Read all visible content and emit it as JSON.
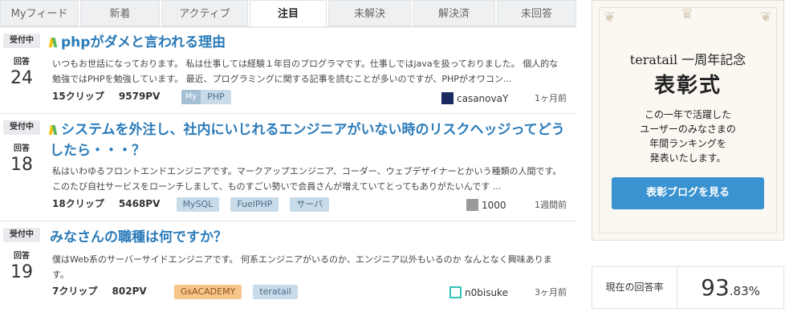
{
  "tabs": [
    "Myフィード",
    "新着",
    "アクティブ",
    "注目",
    "未解決",
    "解決済",
    "未回答"
  ],
  "questions": [
    {
      "status": "受付中",
      "answers_label": "回答",
      "answers": "24",
      "title": "phpがダメと言われる理由",
      "body": "いつもお世話になっております。 私は仕事しては経験１年目のプログラマです。仕事しではjavaを扱っておりました。 個人的な勉強ではPHPを勉強しています。 最近、プログラミングに関する記事を読むことが多いのですが、PHPがオワコン...",
      "clips": "15クリップ",
      "pv": "9579PV",
      "tag_my": "My",
      "tags": [
        "PHP"
      ],
      "user": "casanovaY",
      "time": "1ヶ月前"
    },
    {
      "status": "受付中",
      "answers_label": "回答",
      "answers": "18",
      "title": "システムを外注し、社内にいじれるエンジニアがいない時のリスクヘッジってどうしたら・・・？",
      "body": "私はいわゆるフロントエンドエンジニアです。マークアップエンジニア、コーダー、ウェブデザイナーとかいう種類の人間です。 このたび自社サービスをローンチしまして、ものすごい勢いで会員さんが増えていてとってもありがたいんです ...",
      "clips": "18クリップ",
      "pv": "5468PV",
      "tags": [
        "MySQL",
        "FuelPHP",
        "サーバ"
      ],
      "user": "1000",
      "time": "1週間前"
    },
    {
      "status": "受付中",
      "answers_label": "回答",
      "answers": "19",
      "title": "みなさんの職種は何ですか？",
      "body": "僕はWeb系のサーバーサイドエンジニアです。 何系エンジニアがいるのか、エンジニア以外もいるのか なんとなく興味あります。",
      "clips": "7クリップ",
      "pv": "802PV",
      "tags": [
        "GsACADEMY",
        "teratail"
      ],
      "user": "n0bisuke",
      "time": "3ヶ月前"
    }
  ],
  "ad": {
    "title_line1": "teratail 一周年記念",
    "title_line2": "表彰式",
    "desc1": "この一年で活躍した",
    "desc2": "ユーザーのみなさまの",
    "desc3": "年間ランキングを",
    "desc4": "発表いたします。",
    "button": "表彰ブログを見る"
  },
  "answer_rate": {
    "label": "現在の回答率",
    "value_int": "93",
    "value_dec": ".83%"
  },
  "colors": {
    "link": "#2b7bb9",
    "button": "#3a93d0",
    "tag": "#c7dbe8",
    "tag_orange": "#f7c48a"
  }
}
